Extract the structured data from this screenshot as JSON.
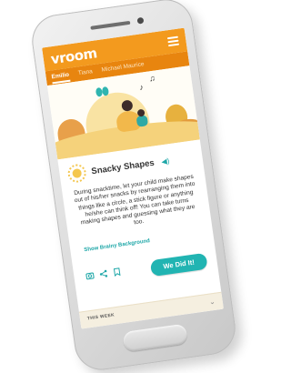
{
  "app": {
    "logo": "vroom",
    "tabs": [
      {
        "label": "Emilio",
        "active": true
      },
      {
        "label": "Tiana",
        "active": false
      },
      {
        "label": "Michael Maurice",
        "active": false
      }
    ]
  },
  "card": {
    "title": "Snacky Shapes",
    "body": "During snacktime, let your child make shapes out of his/her snacks by rearranging them into things like a circle, a stick figure or anything he/she can think off! You can take turns making shapes and guessing what they are too.",
    "brainy_link": "Show Brainy Background",
    "did_it_label": "We Did It!"
  },
  "footer": {
    "week_label": "THIS WEEK"
  },
  "colors": {
    "header": "#f39a1e",
    "tabs_bar": "#e8850f",
    "accent": "#21b4b2"
  },
  "icons": [
    "menu-icon",
    "sun-icon",
    "speaker-icon",
    "camera-icon",
    "share-icon",
    "bookmark-icon",
    "chevron-down-icon"
  ]
}
